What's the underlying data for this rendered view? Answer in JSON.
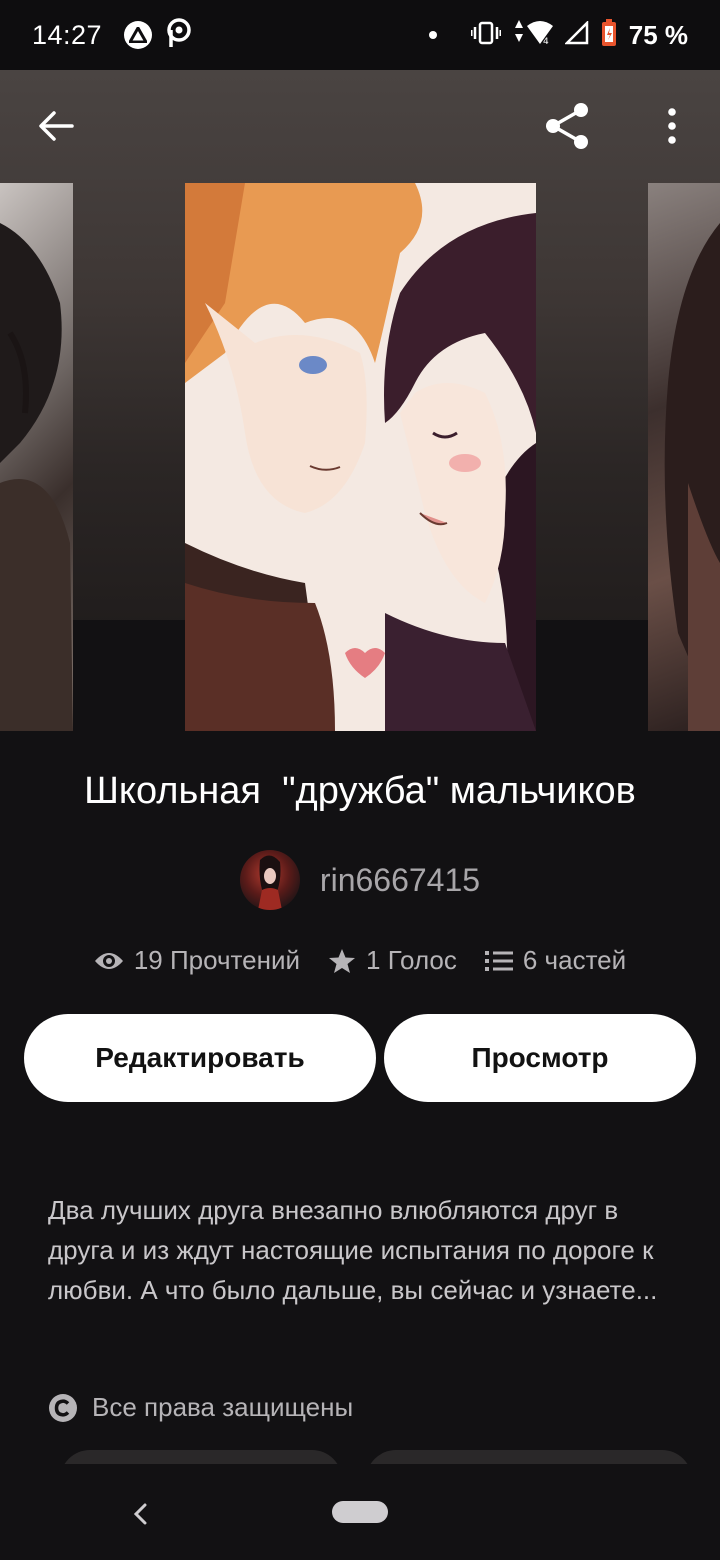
{
  "status_bar": {
    "time": "14:27",
    "battery": "75 %",
    "icons": [
      "app-notification-icon",
      "parking-app-icon",
      "dot-icon",
      "vibrate-icon",
      "wifi-icon",
      "signal-icon",
      "battery-icon"
    ]
  },
  "toolbar": {
    "back_icon": "arrow-left-icon",
    "share_icon": "share-icon",
    "more_icon": "more-vertical-icon"
  },
  "story": {
    "title": "Школьная  \"дружба\" мальчиков",
    "author": "rin6667415",
    "stats": {
      "reads": "19 Прочтений",
      "votes": "1 Голос",
      "parts": "6 частей"
    },
    "description": "Два лучших друга внезапно влюбляются друг в друга и из ждут настоящие испытания по дороге к любви. А что было дальше, вы сейчас и узнаете...",
    "copyright": "Все права защищены"
  },
  "actions": {
    "edit_label": "Редактировать",
    "view_label": "Просмотр"
  },
  "colors": {
    "background": "#121113",
    "button_bg": "#ffffff",
    "muted_text": "#b6b4b7"
  }
}
